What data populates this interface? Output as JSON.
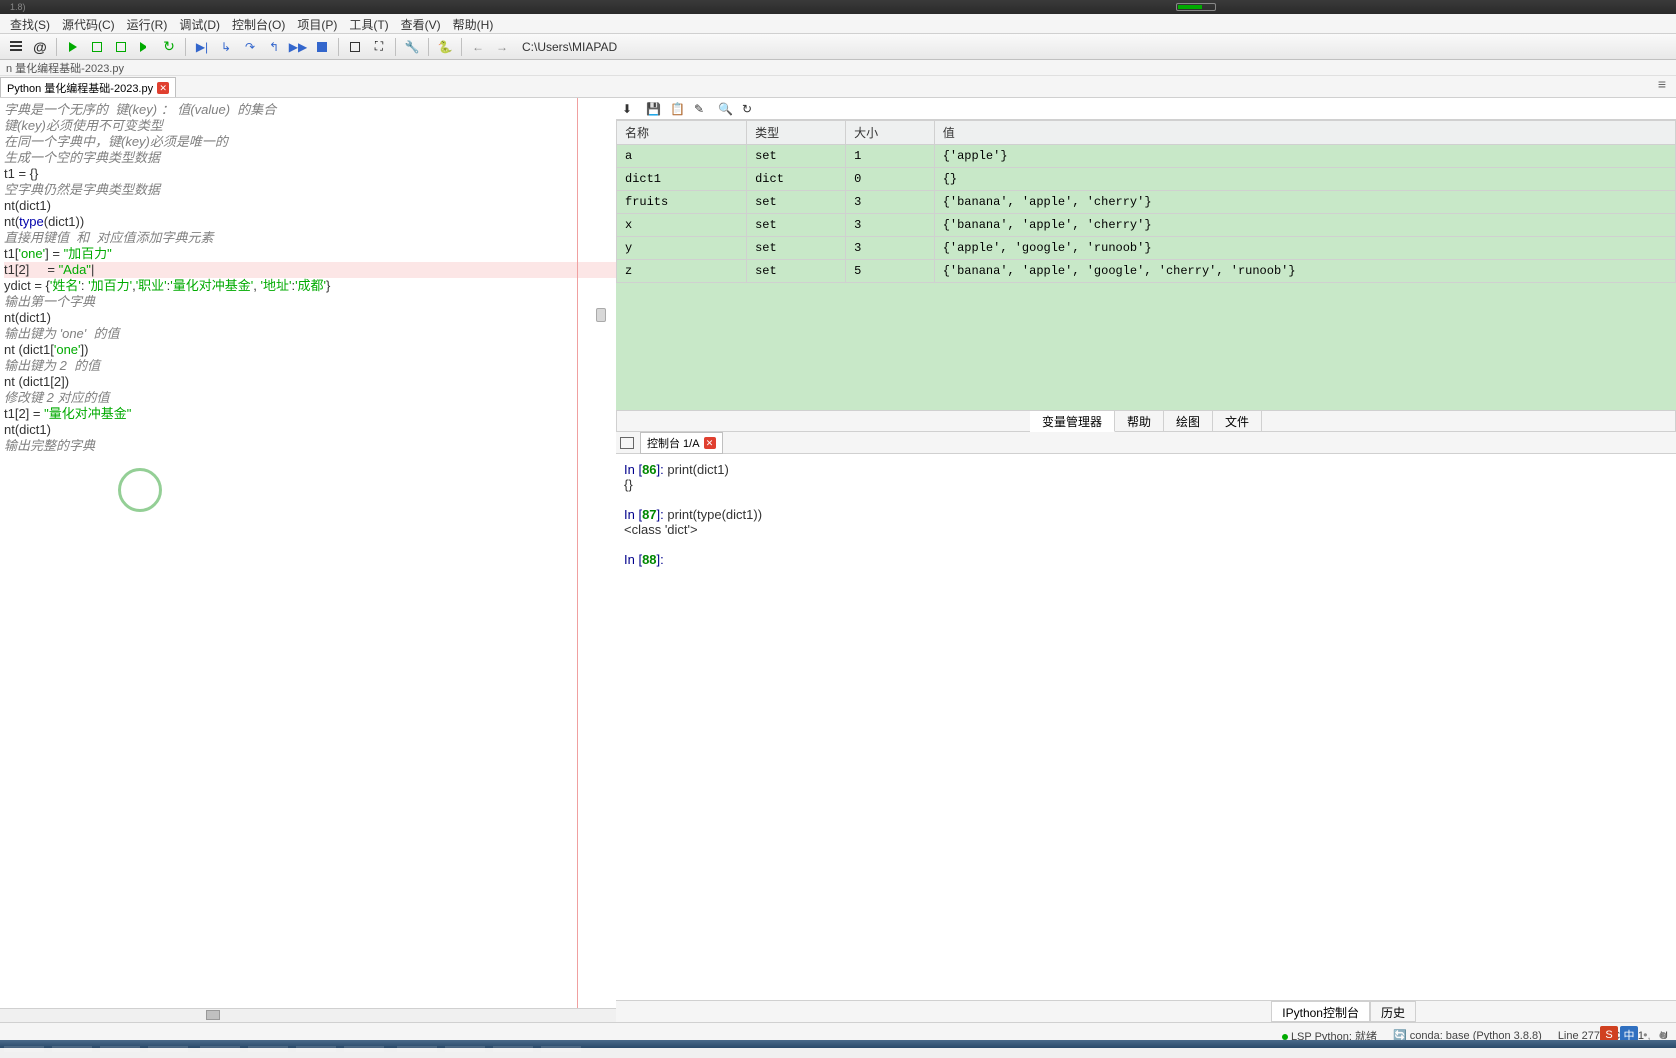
{
  "titlebar": {
    "version": "1.8)"
  },
  "menubar": [
    "查找(S)",
    "源代码(C)",
    "运行(R)",
    "调试(D)",
    "控制台(O)",
    "项目(P)",
    "工具(T)",
    "查看(V)",
    "帮助(H)"
  ],
  "toolbar": {
    "path": "C:\\Users\\MIAPAD"
  },
  "breadcrumb": "n  量化编程基础-2023.py",
  "filetab": {
    "name": "Python  量化编程基础-2023.py"
  },
  "editor_lines": [
    {
      "t": "字典是一个无序的  键(key) ： 值(value)  的集合",
      "c": "comment"
    },
    {
      "t": "",
      "c": ""
    },
    {
      "t": "",
      "c": ""
    },
    {
      "t": "键(key)必须使用不可变类型",
      "c": "comment"
    },
    {
      "t": "",
      "c": ""
    },
    {
      "t": "",
      "c": ""
    },
    {
      "t": "在同一个字典中，键(key)必须是唯一的",
      "c": "comment"
    },
    {
      "t": "",
      "c": ""
    },
    {
      "t": "",
      "c": ""
    },
    {
      "t": "",
      "c": ""
    },
    {
      "t": "生成一个空的字典类型数据",
      "c": "comment"
    },
    {
      "t": "t1 = {}",
      "c": ""
    },
    {
      "t": "",
      "c": ""
    },
    {
      "t": "空字典仍然是字典类型数据",
      "c": "comment"
    },
    {
      "t": "nt(dict1)",
      "c": "code-print"
    },
    {
      "t": "nt(type(dict1))",
      "c": "code-print"
    },
    {
      "t": "",
      "c": ""
    },
    {
      "t": "直接用键值  和  对应值添加字典元素",
      "c": "comment"
    },
    {
      "t": "t1['one'] = \"加百力\"",
      "c": "code-assign"
    },
    {
      "t": "t1[2]     = \"Ada\"|",
      "c": "code-assign highlight",
      "hl": true
    },
    {
      "t": "",
      "c": ""
    },
    {
      "t": "ydict = {'姓名': '加百力','职业':'量化对冲基金', '地址':'成都'}",
      "c": "code-dict"
    },
    {
      "t": "",
      "c": ""
    },
    {
      "t": "输出第一个字典",
      "c": "comment"
    },
    {
      "t": "nt(dict1)",
      "c": "code-print"
    },
    {
      "t": "",
      "c": ""
    },
    {
      "t": "输出键为 'one'  的值",
      "c": "comment"
    },
    {
      "t": "nt (dict1['one'])",
      "c": "code-print"
    },
    {
      "t": "",
      "c": ""
    },
    {
      "t": "输出键为 2  的值",
      "c": "comment"
    },
    {
      "t": "nt (dict1[2])",
      "c": "code-print"
    },
    {
      "t": "",
      "c": ""
    },
    {
      "t": "",
      "c": ""
    },
    {
      "t": "修改键 2 对应的值",
      "c": "comment"
    },
    {
      "t": "t1[2] = \"量化对冲基金\"",
      "c": "code-assign"
    },
    {
      "t": "nt(dict1)",
      "c": "code-print"
    },
    {
      "t": "",
      "c": ""
    },
    {
      "t": "",
      "c": ""
    },
    {
      "t": "输出完整的字典",
      "c": "comment"
    }
  ],
  "var_table": {
    "headers": [
      "名称",
      "类型",
      "大小",
      "值"
    ],
    "rows": [
      {
        "name": "a",
        "type": "set",
        "size": "1",
        "val": "{'apple'}"
      },
      {
        "name": "dict1",
        "type": "dict",
        "size": "0",
        "val": "{}"
      },
      {
        "name": "fruits",
        "type": "set",
        "size": "3",
        "val": "{'banana', 'apple', 'cherry'}"
      },
      {
        "name": "x",
        "type": "set",
        "size": "3",
        "val": "{'banana', 'apple', 'cherry'}"
      },
      {
        "name": "y",
        "type": "set",
        "size": "3",
        "val": "{'apple', 'google', 'runoob'}"
      },
      {
        "name": "z",
        "type": "set",
        "size": "5",
        "val": "{'banana', 'apple', 'google', 'cherry', 'runoob'}"
      }
    ]
  },
  "right_tabs": [
    "变量管理器",
    "帮助",
    "绘图",
    "文件"
  ],
  "right_tab_active": 0,
  "console_tab": "控制台 1/A",
  "console_lines": [
    {
      "type": "in",
      "n": "86",
      "cmd": "print(dict1)"
    },
    {
      "type": "out",
      "txt": "{}"
    },
    {
      "type": "blank"
    },
    {
      "type": "in",
      "n": "87",
      "cmd": "print(type(dict1))"
    },
    {
      "type": "out",
      "txt": "<class 'dict'>"
    },
    {
      "type": "blank"
    },
    {
      "type": "in",
      "n": "88",
      "cmd": ""
    }
  ],
  "bottom_tabs": [
    "IPython控制台",
    "历史"
  ],
  "bottom_tab_active": 0,
  "statusbar": {
    "lsp": "LSP Python: 就绪",
    "conda": "conda: base (Python 3.8.8)",
    "pos": "Line 2779, Col 21",
    "enc": "U"
  },
  "ime": {
    "s": "S",
    "c": "中"
  }
}
